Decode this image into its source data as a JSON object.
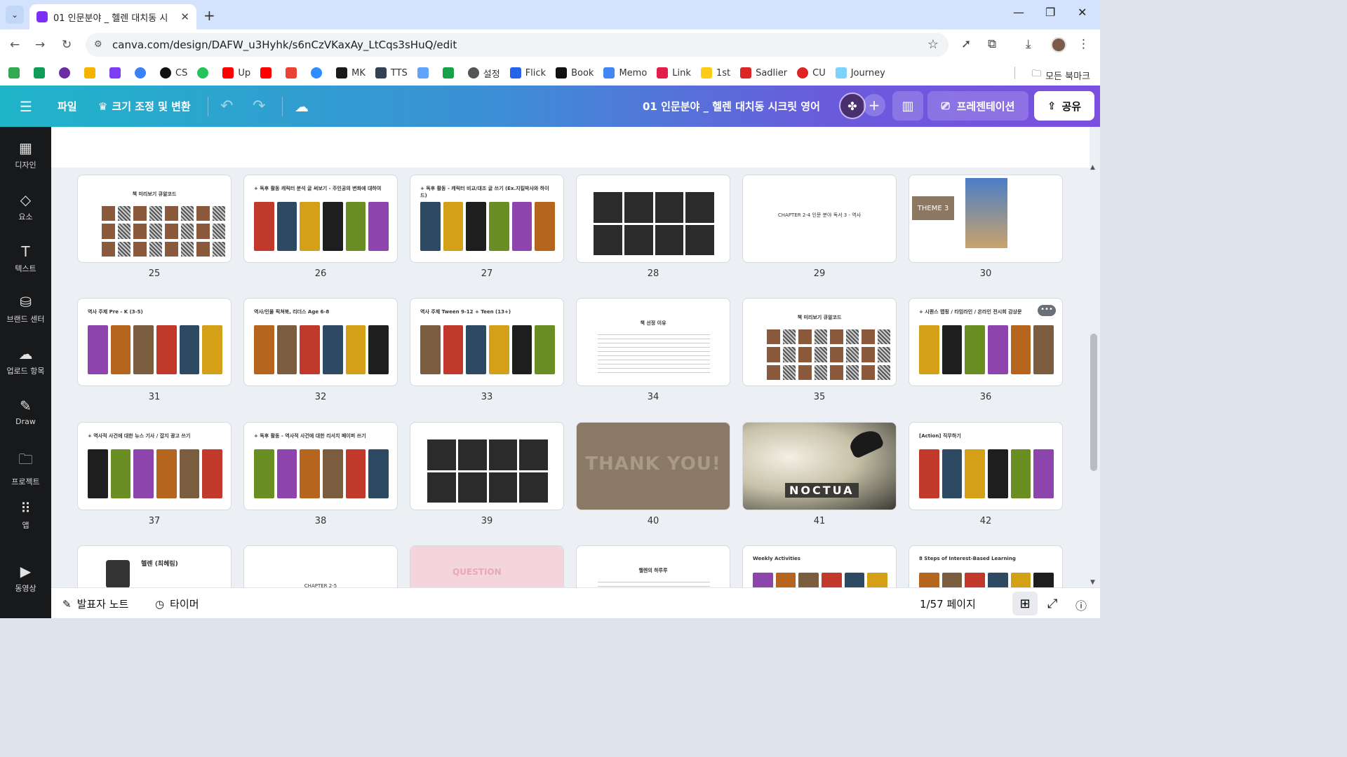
{
  "browser": {
    "tab_title": "01 인문분야 _ 헬렌 대치동 시",
    "url": "canva.com/design/DAFW_u3Hyhk/s6nCzVKaxAy_LtCqs3sHuQ/edit",
    "bookmarks": [
      "CS",
      "Up",
      "MK",
      "TTS",
      "설정",
      "Flick",
      "Book",
      "Memo",
      "Link",
      "1st",
      "Sadlier",
      "CU",
      "Journey"
    ],
    "all_bookmarks": "모든 북마크"
  },
  "canva": {
    "menu": {
      "file": "파일",
      "resize": "크기 조정 및 변환"
    },
    "doc_title": "01 인문분야 _ 헬렌 대치동 시크릿 영어",
    "present_label": "프레젠테이션",
    "share_label": "공유",
    "rail": [
      {
        "label": "디자인",
        "icon": "layout-icon"
      },
      {
        "label": "요소",
        "icon": "shapes-icon"
      },
      {
        "label": "텍스트",
        "icon": "text-icon"
      },
      {
        "label": "브랜드 센터",
        "icon": "brand-icon"
      },
      {
        "label": "업로드 항목",
        "icon": "upload-icon"
      },
      {
        "label": "Draw",
        "icon": "draw-icon"
      },
      {
        "label": "프로젝트",
        "icon": "folder-icon"
      },
      {
        "label": "앱",
        "icon": "apps-icon"
      },
      {
        "label": "동영상",
        "icon": "video-icon"
      }
    ],
    "pages": [
      {
        "n": "25",
        "head": "책 미리보기 큐알코드",
        "kind": "qr"
      },
      {
        "n": "26",
        "head": "+ 독후 활동 캐릭터 분석 글 써보기 - 주인공의 변화에 대하여",
        "kind": "book"
      },
      {
        "n": "27",
        "head": "+ 독후 활동 - 캐릭터 비교/대조 글 쓰기 (Ex.지킬박사와 하이드)",
        "kind": "pics"
      },
      {
        "n": "28",
        "head": "",
        "kind": "cells"
      },
      {
        "n": "29",
        "head": "CHAPTER 2-4 인문 분야 독서 3 - 역사",
        "kind": "center"
      },
      {
        "n": "30",
        "head": "THEME 3",
        "kind": "theme"
      },
      {
        "n": "31",
        "head": "역사 주제 Pre - K (3-5)",
        "kind": "pics"
      },
      {
        "n": "32",
        "head": "역사/인물 픽쳐북, 리더스 Age 6-8",
        "kind": "pics"
      },
      {
        "n": "33",
        "head": "역사 주제 Tween 9-12 + Teen (13+)",
        "kind": "pics"
      },
      {
        "n": "34",
        "head": "책 선정 이유",
        "kind": "text"
      },
      {
        "n": "35",
        "head": "책 미리보기 큐알코드",
        "kind": "qr"
      },
      {
        "n": "36",
        "head": "+ 시퀀스 맵핑 / 타임라인 / 온라인 전시회 감상문",
        "kind": "pics"
      },
      {
        "n": "37",
        "head": "+ 역사적 사건에 대한 뉴스 기사 / 잡지 광고 쓰기",
        "kind": "pics"
      },
      {
        "n": "38",
        "head": "+ 독후 활동 - 역사적 사건에 대한 리서치 페이퍼 쓰기",
        "kind": "pics"
      },
      {
        "n": "39",
        "head": "",
        "kind": "cells"
      },
      {
        "n": "40",
        "head": "THANK YOU!",
        "kind": "thanks"
      },
      {
        "n": "41",
        "head": "NOCTUA",
        "kind": "lamp"
      },
      {
        "n": "42",
        "head": "[Action] 직무하기",
        "kind": "pics"
      },
      {
        "n": "",
        "head": "헬렌 (최혜림)",
        "kind": "profile"
      },
      {
        "n": "",
        "head": "CHAPTER 2-5",
        "kind": "center"
      },
      {
        "n": "",
        "head": "QUESTION",
        "kind": "question"
      },
      {
        "n": "",
        "head": "헬렌의 하루루",
        "kind": "text"
      },
      {
        "n": "",
        "head": "Weekly Activities",
        "kind": "pics"
      },
      {
        "n": "",
        "head": "8 Steps of Interest-Based Learning",
        "kind": "pics"
      }
    ],
    "footer": {
      "notes": "발표자 노트",
      "timer": "타이머",
      "page_status": "1/57 페이지"
    }
  },
  "colors": {
    "header_start": "#1fb5c9",
    "header_end": "#7b4fe0",
    "rail_bg": "#18191b"
  }
}
